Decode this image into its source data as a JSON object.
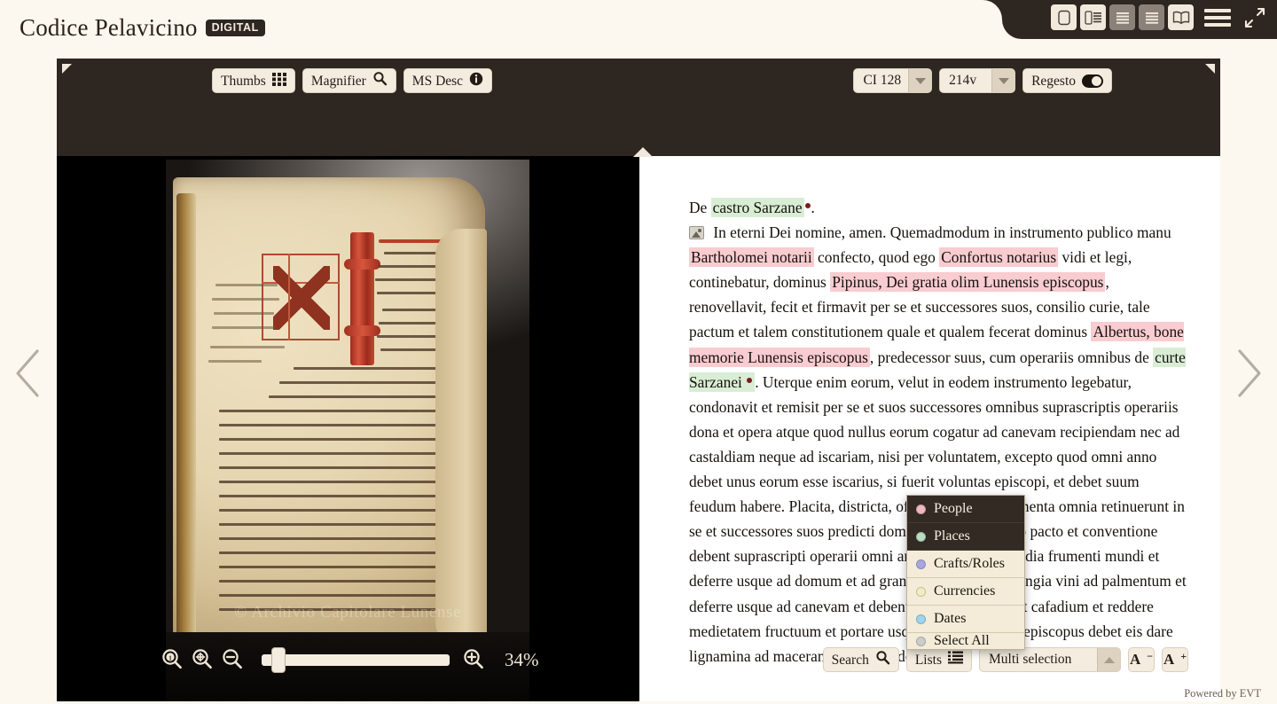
{
  "header": {
    "brand_title": "Codice Pelavicino",
    "brand_badge": "DIGITAL",
    "view_icons": [
      {
        "name": "single-image-view-icon",
        "active": true
      },
      {
        "name": "image-text-view-icon",
        "active": false
      },
      {
        "name": "text-text-view-icon",
        "active": false
      },
      {
        "name": "book-reader-view-icon",
        "active": false
      }
    ],
    "menu_icon": "hamburger-menu-icon",
    "fullscreen_icon": "fullscreen-expand-icon"
  },
  "toolbar_top": {
    "thumbs_label": "Thumbs",
    "magnifier_label": "Magnifier",
    "ms_desc_label": "MS Desc",
    "manuscript_select": "CI 128",
    "folio_select": "214v",
    "regesto_label": "Regesto",
    "regesto_on": true
  },
  "image_pane": {
    "watermark": "© Archivio Capitolare Lunense",
    "rubric_text": "De castro Sarzane"
  },
  "text_pane": {
    "heading_prefix": "De ",
    "heading_place": "castro Sarzane",
    "heading_suffix": ".",
    "paragraph": [
      {
        "t": "  In eterni Dei nomine, amen. Quemadmodum in instrumento publico manu ",
        "k": "plain"
      },
      {
        "t": "Bartholomei notarii",
        "k": "person"
      },
      {
        "t": " confecto, quod ego ",
        "k": "plain"
      },
      {
        "t": "Confortus notarius",
        "k": "person"
      },
      {
        "t": " vidi et legi, continebatur, dominus ",
        "k": "plain"
      },
      {
        "t": "Pipinus, Dei gratia olim Lunensis episcopus",
        "k": "person"
      },
      {
        "t": ", renovellavit, fecit et firmavit per se et successores suos, consilio curie, tale pactum et talem constitutionem quale et qualem fecerat dominus ",
        "k": "plain"
      },
      {
        "t": "Albertus, bone memorie Lunensis episcopus",
        "k": "person"
      },
      {
        "t": ", predecessor suus, cum operariis omnibus de ",
        "k": "plain"
      },
      {
        "t": "curte Sarzanei ",
        "k": "place-dot"
      },
      {
        "t": ". Uterque enim eorum, velut in eodem instrumento legebatur, condonavit et remisit per se et suos successores omnibus suprascriptis operariis dona et opera atque quod nullus eorum cogatur ad canevam recipiendam nec ad castaldiam neque ad iscariam, nisi per voluntatem, excepto quod omni anno debet unus eorum esse iscarius, si fuerit voluntas episcopi, et debet suum feudum habere. Placita, districta, offensiones, amasiamenta omnia retinuerunt in se et successores suos predicti domini pro suprascripto pacto et conventione debent suprascripti operarii omni anno dare viginti modia frumenti mundi et deferre usque ad domum et ad granarium et centum congia vini ad palmentum et deferre usque ad canevam et debent laborare bradias et cafadium et reddere medietatem fructuum et portare usque in canevam. Et episcopus debet eis dare lignamina ad macerandum et ipsi debent",
        "k": "plain"
      }
    ]
  },
  "dropdown": {
    "items": [
      {
        "label": "People",
        "color": "#f0b9bd",
        "selected": true
      },
      {
        "label": "Places",
        "color": "#b9ddc2",
        "selected": true
      },
      {
        "label": "Crafts/Roles",
        "color": "#a9a6dd",
        "selected": false
      },
      {
        "label": "Currencies",
        "color": "#f4ecc0",
        "selected": false
      },
      {
        "label": "Dates",
        "color": "#9fd4ee",
        "selected": false
      },
      {
        "label": "Select All",
        "color": "#cccccc",
        "selected": false
      }
    ]
  },
  "toolbar_bottom": {
    "zoom_reset_icon": "zoom-actual-size-icon",
    "zoom_fit_icon": "zoom-fit-screen-icon",
    "zoom_out_icon": "zoom-out-icon",
    "zoom_in_icon": "zoom-in-icon",
    "zoom_percent": "34%",
    "slider_value": 6,
    "search_label": "Search",
    "lists_label": "Lists",
    "selection_mode": "Multi selection",
    "font_decrease": "A",
    "font_decrease_sign": "−",
    "font_increase": "A",
    "font_increase_sign": "+"
  },
  "footer": {
    "powered_by": "Powered by EVT"
  },
  "nav": {
    "prev_icon": "chevron-left-icon",
    "next_icon": "chevron-right-icon"
  },
  "colors": {
    "page_bg": "#fdf8ef",
    "chrome_dark": "#2e2620",
    "button_bg": "#f4ecdf",
    "highlight_person": "#f8ccd0",
    "highlight_place": "#d9edd5"
  }
}
